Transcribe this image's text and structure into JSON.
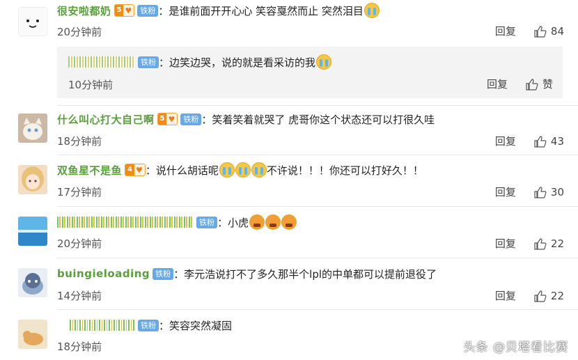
{
  "comments": [
    {
      "username": "很安啦都奶",
      "level": "5",
      "fan_badge": "铁粉",
      "text": "：是谁前面开开心心 笑容戛然而止 突然泪目",
      "emoji": [
        "cry"
      ],
      "time": "20分钟前",
      "reply_label": "回复",
      "likes": "84",
      "reply": {
        "username": "",
        "fan_badge": "铁粉",
        "text": "：边笑边哭，说的就是看采访的我",
        "emoji": [
          "cry"
        ],
        "time": "10分钟前",
        "reply_label": "回复",
        "likes": "赞"
      }
    },
    {
      "username": "什么叫心打大自己啊",
      "level": "5",
      "fan_badge": "铁粉",
      "text": "：笑着笑着就哭了 虎哥你这个状态还可以打很久哇",
      "emoji": [],
      "time": "18分钟前",
      "reply_label": "回复",
      "likes": "43"
    },
    {
      "username": "双鱼星不是鱼",
      "level": "4",
      "fan_badge": "铁粉",
      "text_before": "：说什么胡话呢",
      "emoji": [
        "cry",
        "cry",
        "cry"
      ],
      "text": "不许说！！！你还可以打好久！！",
      "time": "17分钟前",
      "reply_label": "回复",
      "likes": "30"
    },
    {
      "username": "",
      "level": "",
      "fan_badge": "铁粉",
      "text": "：小虎",
      "emoji": [
        "angry",
        "angry",
        "angry"
      ],
      "time": "20分钟前",
      "reply_label": "回复",
      "likes": "22"
    },
    {
      "username": "buingieloading",
      "level": "",
      "fan_badge": "铁粉",
      "text": "：李元浩说打不了多久那半个lpl的中单都可以提前退役了",
      "emoji": [],
      "time": "14分钟前",
      "reply_label": "回复",
      "likes": "22"
    },
    {
      "username": "",
      "level": "",
      "fan_badge": "铁粉",
      "text": "：笑容突然凝固",
      "emoji": [],
      "time": "18分钟前"
    }
  ],
  "watermark": "头条 @贝塔看比赛",
  "colors": {
    "username": "#5aa03a",
    "fan_badge": "#66a9e6",
    "level_badge": "#f08c18"
  }
}
